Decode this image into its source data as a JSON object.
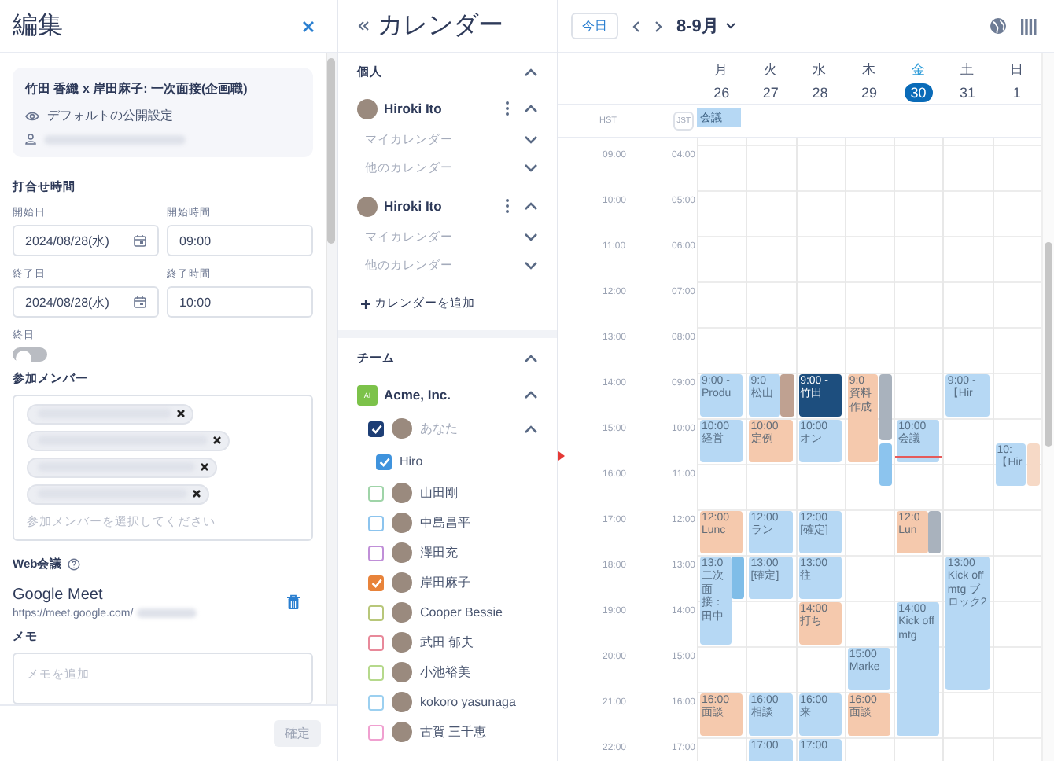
{
  "edit_panel": {
    "title": "編集",
    "event_card": {
      "title": "竹田 香織 x 岸田麻子: 一次面接(企画職)",
      "visibility": "デフォルトの公開設定",
      "owner": {
        "kind": "redacted"
      }
    },
    "meeting_time": {
      "heading": "打合せ時間",
      "fields": [
        {
          "label": "開始日",
          "value": "2024/08/28(水)",
          "kind": "date"
        },
        {
          "label": "開始時間",
          "value": "09:00",
          "kind": "time"
        },
        {
          "label": "終了日",
          "value": "2024/08/28(水)",
          "kind": "date"
        },
        {
          "label": "終了時間",
          "value": "10:00",
          "kind": "time"
        }
      ]
    },
    "all_day": {
      "label": "終日",
      "on": false
    },
    "members": {
      "heading": "参加メンバー",
      "placeholder": "参加メンバーを選択してください",
      "chips": [
        {
          "kind": "redacted"
        },
        {
          "kind": "redacted"
        },
        {
          "kind": "redacted"
        },
        {
          "kind": "redacted"
        }
      ]
    },
    "web_meeting": {
      "heading": "Web会議",
      "service": "Google Meet",
      "url": "https://meet.google.com/",
      "url_tail": {
        "kind": "redacted"
      }
    },
    "memo": {
      "heading": "メモ",
      "placeholder": "メモを追加"
    },
    "confirm_button": {
      "label": "確定",
      "disabled": true
    }
  },
  "calendars": {
    "title": "カレンダー",
    "personal": {
      "heading": "個人",
      "expanded": true,
      "accounts": [
        {
          "name": "Hiroki Ito",
          "expanded": true,
          "items": [
            {
              "label": "マイカレンダー",
              "expanded": false
            },
            {
              "label": "他のカレンダー",
              "expanded": false
            }
          ]
        },
        {
          "name": "Hiroki Ito",
          "expanded": true,
          "items": [
            {
              "label": "マイカレンダー",
              "expanded": false
            },
            {
              "label": "他のカレンダー",
              "expanded": false
            }
          ]
        }
      ],
      "add_label": "カレンダーを追加"
    },
    "team": {
      "heading": "チーム",
      "expanded": true,
      "org": {
        "name": "Acme, Inc.",
        "logo": "AI",
        "expanded": true
      },
      "you": {
        "label": "あなた",
        "checked": true,
        "expanded": true,
        "children": [
          {
            "label": "Hiro",
            "checked": true
          }
        ]
      },
      "members": [
        {
          "name": "山田剛",
          "checked": false,
          "color": "#9fd4a8"
        },
        {
          "name": "中島昌平",
          "checked": false,
          "color": "#8cc4ee"
        },
        {
          "name": "澤田充",
          "checked": false,
          "color": "#c08fd8"
        },
        {
          "name": "岸田麻子",
          "checked": true,
          "color": "#e8833a"
        },
        {
          "name": "Cooper Bessie",
          "checked": false,
          "color": "#b8c77a"
        },
        {
          "name": "武田 郁夫",
          "checked": false,
          "color": "#e8899a"
        },
        {
          "name": "小池裕美",
          "checked": false,
          "color": "#b6d98c"
        },
        {
          "name": "kokoro yasunaga",
          "checked": false,
          "color": "#9cd0f0"
        },
        {
          "name": "古賀 三千恵",
          "checked": false,
          "color": "#f0a0d0"
        }
      ]
    }
  },
  "week": {
    "today_button": "今日",
    "range": "8-9月",
    "timezones": [
      "HST",
      "JST"
    ],
    "hours": [
      {
        "hst": "09:00",
        "jst": "04:00"
      },
      {
        "hst": "10:00",
        "jst": "05:00"
      },
      {
        "hst": "11:00",
        "jst": "06:00"
      },
      {
        "hst": "12:00",
        "jst": "07:00"
      },
      {
        "hst": "13:00",
        "jst": "08:00"
      },
      {
        "hst": "14:00",
        "jst": "09:00"
      },
      {
        "hst": "15:00",
        "jst": "10:00"
      },
      {
        "hst": "16:00",
        "jst": "11:00"
      },
      {
        "hst": "17:00",
        "jst": "12:00"
      },
      {
        "hst": "18:00",
        "jst": "13:00"
      },
      {
        "hst": "19:00",
        "jst": "14:00"
      },
      {
        "hst": "20:00",
        "jst": "15:00"
      },
      {
        "hst": "21:00",
        "jst": "16:00"
      },
      {
        "hst": "22:00",
        "jst": "17:00"
      }
    ],
    "days": [
      {
        "weekday": "月",
        "date": "26",
        "selected": false,
        "all_day": [
          {
            "title": "会議",
            "color": "#b6d8f4"
          }
        ],
        "slots": [
          {
            "kind": "free"
          },
          {
            "kind": "free"
          },
          {
            "kind": "free"
          },
          {
            "kind": "free"
          },
          {
            "kind": "free"
          },
          {
            "kind": "busy",
            "events": [
              {
                "kind": "hour",
                "time": "9:00 -",
                "title": "Produ",
                "color": "#b6d8f4"
              }
            ]
          },
          {
            "kind": "busy",
            "events": [
              {
                "kind": "hour",
                "time": "10:00",
                "title": "経営",
                "color": "#b6d8f4"
              }
            ]
          },
          {
            "kind": "free"
          },
          {
            "kind": "busy",
            "events": [
              {
                "kind": "hour",
                "time": "12:00",
                "title": "Lunc",
                "color": "#f5c9ad"
              }
            ]
          },
          {
            "kind": "busy",
            "events": [
              {
                "kind": "twohour",
                "time": "13:0",
                "title": "二次面接：田中",
                "color": "#b6d8f4"
              },
              {
                "kind": "overlay",
                "color": "#7fbde8"
              }
            ]
          },
          {
            "kind": "free"
          },
          {
            "kind": "free"
          },
          {
            "kind": "busy",
            "events": [
              {
                "kind": "hour",
                "time": "16:00",
                "title": "面談",
                "color": "#f5c9ad"
              }
            ]
          },
          {
            "kind": "free"
          }
        ]
      },
      {
        "weekday": "火",
        "date": "27",
        "selected": false,
        "slots": [
          {
            "kind": "free"
          },
          {
            "kind": "free"
          },
          {
            "kind": "free"
          },
          {
            "kind": "free"
          },
          {
            "kind": "free"
          },
          {
            "kind": "busy",
            "events": [
              {
                "kind": "hour",
                "time": "9:0",
                "title": "松山",
                "color": "#b6d8f4"
              },
              {
                "kind": "overlay",
                "color": "#bfa191"
              }
            ]
          },
          {
            "kind": "busy",
            "events": [
              {
                "kind": "hour",
                "time": "10:00",
                "title": "定例",
                "color": "#f5c9ad"
              }
            ]
          },
          {
            "kind": "free"
          },
          {
            "kind": "busy",
            "events": [
              {
                "kind": "hour",
                "time": "12:00",
                "title": "ラン",
                "color": "#b6d8f4"
              }
            ]
          },
          {
            "kind": "busy",
            "events": [
              {
                "kind": "hour",
                "time": "13:00",
                "title": "[確定]",
                "color": "#b6d8f4"
              }
            ]
          },
          {
            "kind": "free"
          },
          {
            "kind": "free"
          },
          {
            "kind": "busy",
            "events": [
              {
                "kind": "hour",
                "time": "16:00",
                "title": "相談",
                "color": "#b6d8f4"
              }
            ]
          },
          {
            "kind": "busy",
            "events": [
              {
                "kind": "hour",
                "time": "17:00",
                "color": "#b6d8f4"
              }
            ]
          }
        ]
      },
      {
        "weekday": "水",
        "date": "28",
        "selected": false,
        "slots": [
          {
            "kind": "free"
          },
          {
            "kind": "free"
          },
          {
            "kind": "free"
          },
          {
            "kind": "free"
          },
          {
            "kind": "free"
          },
          {
            "kind": "busy",
            "events": [
              {
                "kind": "hour",
                "time": "9:00 -",
                "title": "竹田",
                "color": "#1d4e7e"
              }
            ]
          },
          {
            "kind": "busy",
            "events": [
              {
                "kind": "hour",
                "time": "10:00",
                "title": "オン",
                "color": "#b6d8f4"
              }
            ]
          },
          {
            "kind": "free"
          },
          {
            "kind": "busy",
            "events": [
              {
                "kind": "hour",
                "time": "12:00",
                "title": "[確定]",
                "color": "#b6d8f4"
              }
            ]
          },
          {
            "kind": "busy",
            "events": [
              {
                "kind": "hour",
                "time": "13:00",
                "title": "往",
                "color": "#b6d8f4"
              }
            ]
          },
          {
            "kind": "busy",
            "events": [
              {
                "kind": "hour",
                "time": "14:00",
                "title": "打ち",
                "color": "#f5c9ad"
              }
            ]
          },
          {
            "kind": "free"
          },
          {
            "kind": "busy",
            "events": [
              {
                "kind": "hour",
                "time": "16:00",
                "title": "来",
                "color": "#b6d8f4"
              }
            ]
          },
          {
            "kind": "busy",
            "events": [
              {
                "kind": "hour",
                "time": "17:00",
                "color": "#b6d8f4"
              }
            ]
          }
        ]
      },
      {
        "weekday": "木",
        "date": "29",
        "selected": false,
        "slots": [
          {
            "kind": "free"
          },
          {
            "kind": "free"
          },
          {
            "kind": "free"
          },
          {
            "kind": "free"
          },
          {
            "kind": "free"
          },
          {
            "kind": "busy",
            "events": [
              {
                "kind": "twohour",
                "time": "9:0",
                "title": "資料作成",
                "color": "#f5c9ad"
              },
              {
                "kind": "overlaylong",
                "color": "#a9b2bd"
              }
            ]
          },
          {
            "kind": "busy",
            "events": [
              {
                "kind": "overlayhalfpast",
                "color": "#8cc4ee"
              }
            ]
          },
          {
            "kind": "free"
          },
          {
            "kind": "free"
          },
          {
            "kind": "free"
          },
          {
            "kind": "free"
          },
          {
            "kind": "busy",
            "events": [
              {
                "kind": "hour",
                "time": "15:00",
                "title": "Marke",
                "color": "#b6d8f4"
              }
            ]
          },
          {
            "kind": "busy",
            "events": [
              {
                "kind": "hour",
                "time": "16:00",
                "title": "面談",
                "color": "#f5c9ad"
              }
            ]
          },
          {
            "kind": "free"
          }
        ]
      },
      {
        "weekday": "金",
        "date": "30",
        "selected": true,
        "slots": [
          {
            "kind": "free"
          },
          {
            "kind": "free"
          },
          {
            "kind": "free"
          },
          {
            "kind": "free"
          },
          {
            "kind": "free"
          },
          {
            "kind": "free"
          },
          {
            "kind": "busy",
            "events": [
              {
                "kind": "hour",
                "time": "10:00",
                "title": "会議",
                "color": "#b6d8f4"
              },
              {
                "kind": "now"
              }
            ]
          },
          {
            "kind": "free"
          },
          {
            "kind": "busy",
            "events": [
              {
                "kind": "hour",
                "time": "12:0",
                "title": "Lun",
                "color": "#f5c9ad"
              },
              {
                "kind": "overlay",
                "color": "#a9b2bd"
              }
            ]
          },
          {
            "kind": "free"
          },
          {
            "kind": "busy",
            "events": [
              {
                "kind": "threehour",
                "time": "14:00",
                "title": "Kick off mtg",
                "color": "#b6d8f4"
              }
            ]
          },
          {
            "kind": "free"
          },
          {
            "kind": "free"
          },
          {
            "kind": "free"
          }
        ]
      },
      {
        "weekday": "土",
        "date": "31",
        "selected": false,
        "slots": [
          {
            "kind": "free"
          },
          {
            "kind": "free"
          },
          {
            "kind": "free"
          },
          {
            "kind": "free"
          },
          {
            "kind": "free"
          },
          {
            "kind": "busy",
            "events": [
              {
                "kind": "hour",
                "time": "9:00 -",
                "title": "【Hir",
                "color": "#b6d8f4"
              }
            ]
          },
          {
            "kind": "free"
          },
          {
            "kind": "free"
          },
          {
            "kind": "free"
          },
          {
            "kind": "busy",
            "events": [
              {
                "kind": "threehour",
                "time": "13:00",
                "title": "Kick off mtg ブロック2",
                "color": "#b6d8f4"
              }
            ]
          },
          {
            "kind": "free"
          },
          {
            "kind": "free"
          },
          {
            "kind": "free"
          },
          {
            "kind": "free"
          }
        ]
      },
      {
        "weekday": "日",
        "date": "1",
        "selected": false,
        "slots": [
          {
            "kind": "free"
          },
          {
            "kind": "free"
          },
          {
            "kind": "free"
          },
          {
            "kind": "free"
          },
          {
            "kind": "free"
          },
          {
            "kind": "free"
          },
          {
            "kind": "busy",
            "events": [
              {
                "kind": "halfpast",
                "time": "10:",
                "title": "【Hir",
                "color": "#b6d8f4"
              },
              {
                "kind": "overlayhalfpast",
                "color": "#f6d9c6"
              }
            ]
          },
          {
            "kind": "free"
          },
          {
            "kind": "free"
          },
          {
            "kind": "free"
          },
          {
            "kind": "free"
          },
          {
            "kind": "free"
          },
          {
            "kind": "free"
          },
          {
            "kind": "free"
          }
        ]
      }
    ]
  }
}
